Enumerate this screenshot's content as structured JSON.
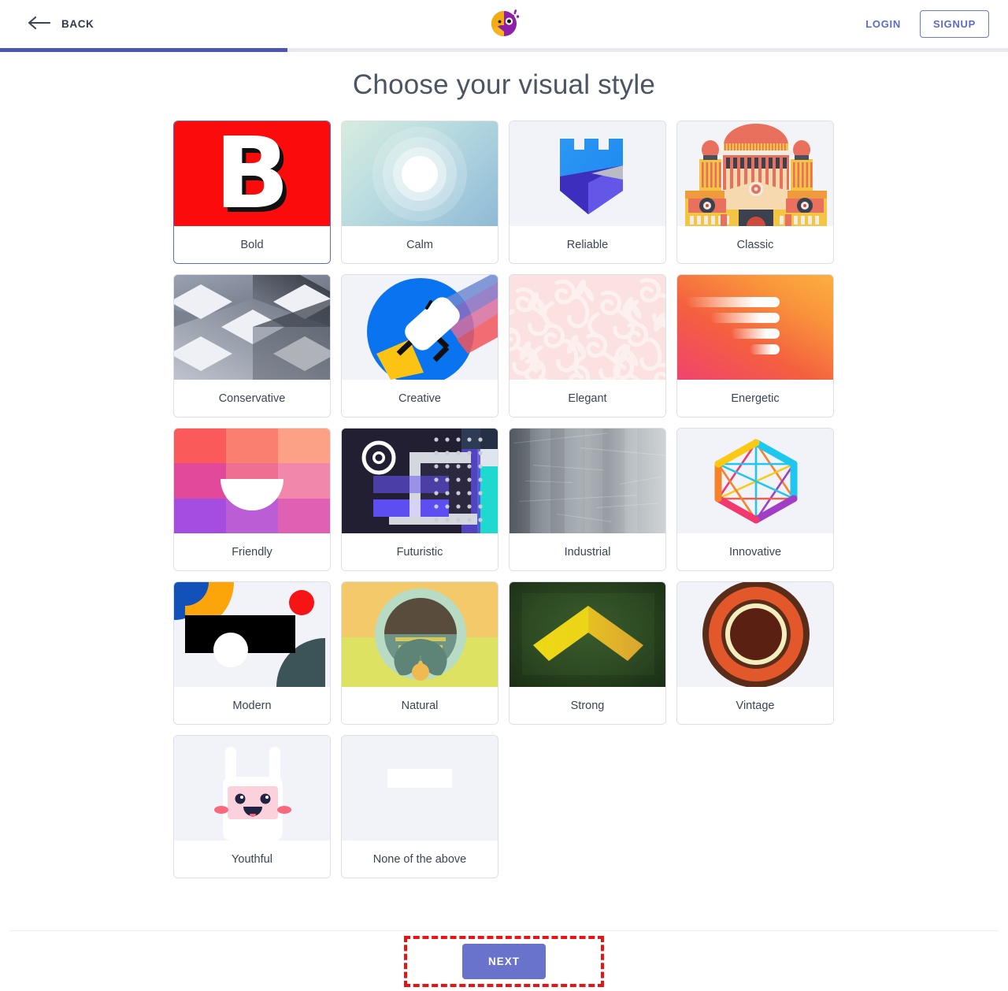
{
  "header": {
    "back_label": "BACK",
    "back_icon": "arrow-left-icon",
    "logo_icon": "parrot-logo-icon",
    "login_label": "LOGIN",
    "signup_label": "SIGNUP",
    "accent_color": "#5b6bc8"
  },
  "progress": {
    "percent": 28.5,
    "fill_color": "#4c55b6",
    "track_color": "#e8eaef"
  },
  "main": {
    "title": "Choose your visual style"
  },
  "styles": [
    {
      "label": "Bold",
      "key": "bold",
      "selected": true
    },
    {
      "label": "Calm",
      "key": "calm",
      "selected": false
    },
    {
      "label": "Reliable",
      "key": "reliable",
      "selected": false
    },
    {
      "label": "Classic",
      "key": "classic",
      "selected": false
    },
    {
      "label": "Conservative",
      "key": "conservative",
      "selected": false
    },
    {
      "label": "Creative",
      "key": "creative",
      "selected": false
    },
    {
      "label": "Elegant",
      "key": "elegant",
      "selected": false
    },
    {
      "label": "Energetic",
      "key": "energetic",
      "selected": false
    },
    {
      "label": "Friendly",
      "key": "friendly",
      "selected": false
    },
    {
      "label": "Futuristic",
      "key": "futuristic",
      "selected": false
    },
    {
      "label": "Industrial",
      "key": "industrial",
      "selected": false
    },
    {
      "label": "Innovative",
      "key": "innovative",
      "selected": false
    },
    {
      "label": "Modern",
      "key": "modern",
      "selected": false
    },
    {
      "label": "Natural",
      "key": "natural",
      "selected": false
    },
    {
      "label": "Strong",
      "key": "strong",
      "selected": false
    },
    {
      "label": "Vintage",
      "key": "vintage",
      "selected": false
    },
    {
      "label": "Youthful",
      "key": "youthful",
      "selected": false
    },
    {
      "label": "None of the above",
      "key": "none",
      "selected": false
    }
  ],
  "thumb_glyphs": {
    "bold_letter": "B"
  },
  "footer": {
    "next_label": "NEXT",
    "next_color": "#6a73cc",
    "annotation_color": "#ee1111"
  }
}
